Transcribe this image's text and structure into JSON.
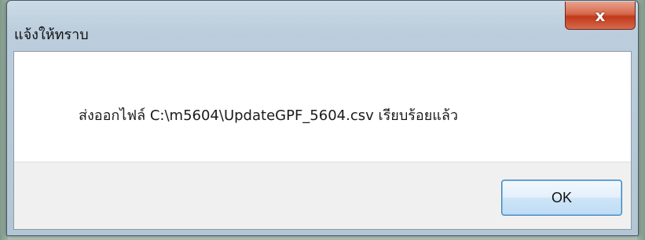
{
  "dialog": {
    "title": "แจ้งให้ทราบ",
    "close_glyph": "x",
    "message": "ส่งออกไฟล์  C:\\m5604\\UpdateGPF_5604.csv  เรียบร้อยแล้ว",
    "ok_label": "OK"
  },
  "colors": {
    "close_button": "#c2391a",
    "ok_border": "#3c7fb1",
    "button_bar": "#f0f0f0"
  }
}
